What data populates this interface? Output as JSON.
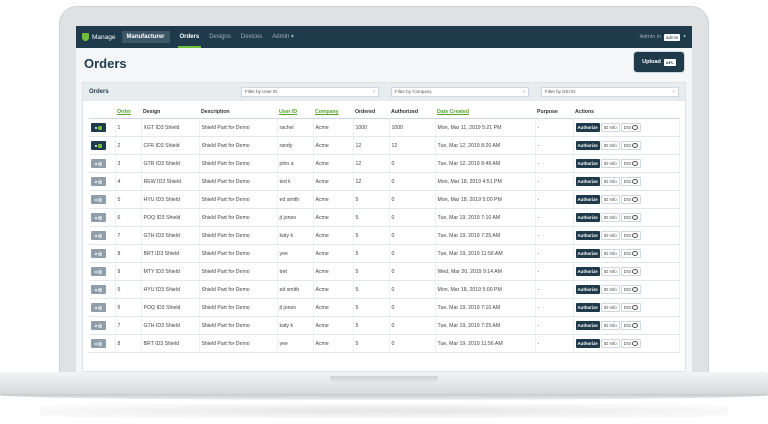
{
  "nav": {
    "brand": "Manage",
    "role": "Manufacturer",
    "items": [
      {
        "label": "Orders",
        "active": true
      },
      {
        "label": "Designs",
        "active": false
      },
      {
        "label": "Devices",
        "active": false
      },
      {
        "label": "Admin ▾",
        "active": false
      }
    ],
    "user_prefix": "Admin in",
    "user_badge": "admin"
  },
  "page": {
    "title": "Orders",
    "upload_label": "Upload",
    "upload_badge": "APL"
  },
  "orders_panel": {
    "title": "Orders",
    "filters": [
      {
        "placeholder": "Filter by User ID"
      },
      {
        "placeholder": "Filter by Company"
      },
      {
        "placeholder": "Filter by DSI ID"
      }
    ]
  },
  "table": {
    "columns": [
      "",
      "Order",
      "Design",
      "Description",
      "User ID",
      "Company",
      "Ordered",
      "Authorized",
      "Date Created",
      "Purpose",
      "Actions"
    ],
    "action_labels": {
      "authorize": "Authorize",
      "id_info": "ID Info",
      "dsi": "DSI"
    },
    "rows": [
      {
        "enabled": true,
        "order": "1",
        "design": "XGT ID3 Shield",
        "description": "Shield Part for Demo",
        "user_id": "rachel",
        "company": "Acme",
        "ordered": "1000",
        "authorized": "1000",
        "date": "Mon, Mar 11, 2019 5:21 PM",
        "purpose": "-"
      },
      {
        "enabled": true,
        "order": "2",
        "design": "CFR ID3 Shield",
        "description": "Shield Part for Demo",
        "user_id": "randy",
        "company": "Acme",
        "ordered": "12",
        "authorized": "12",
        "date": "Tue, Mar 12, 2019 8:20 AM",
        "purpose": "-"
      },
      {
        "enabled": false,
        "order": "3",
        "design": "GTR ID3 Shield",
        "description": "Shield Part for Demo",
        "user_id": "john a",
        "company": "Acme",
        "ordered": "12",
        "authorized": "0",
        "date": "Tue, Mar 12, 2019 8:49 AM",
        "purpose": "-"
      },
      {
        "enabled": false,
        "order": "4",
        "design": "REW ID3 Shield",
        "description": "Shield Part for Demo",
        "user_id": "ted k",
        "company": "Acme",
        "ordered": "12",
        "authorized": "0",
        "date": "Mon, Mar 18, 2019 4:51 PM",
        "purpose": "-"
      },
      {
        "enabled": false,
        "order": "5",
        "design": "HYU ID3 Shield",
        "description": "Shield Part for Demo",
        "user_id": "ed smith",
        "company": "Acme",
        "ordered": "5",
        "authorized": "0",
        "date": "Mon, Mar 18, 2019 5:00 PM",
        "purpose": "-"
      },
      {
        "enabled": false,
        "order": "6",
        "design": "POQ ID3 Shield",
        "description": "Shield Part for Demo",
        "user_id": "jt jones",
        "company": "Acme",
        "ordered": "5",
        "authorized": "0",
        "date": "Tue, Mar 19, 2019 7:10 AM",
        "purpose": "-"
      },
      {
        "enabled": false,
        "order": "7",
        "design": "GTH ID3 Shield",
        "description": "Shield Part for Demo",
        "user_id": "katy k",
        "company": "Acme",
        "ordered": "5",
        "authorized": "0",
        "date": "Tue, Mar 19, 2019 7:25 AM",
        "purpose": "-"
      },
      {
        "enabled": false,
        "order": "8",
        "design": "BRT ID3 Shield",
        "description": "Shield Part for Demo",
        "user_id": "yee",
        "company": "Acme",
        "ordered": "5",
        "authorized": "0",
        "date": "Tue, Mar 19, 2019 11:56 AM",
        "purpose": "-"
      },
      {
        "enabled": false,
        "order": "9",
        "design": "MTY ID3 Shield",
        "description": "Shield Part for Demo",
        "user_id": "tret",
        "company": "Acme",
        "ordered": "5",
        "authorized": "0",
        "date": "Wed, Mar 20, 2019 9:14 AM",
        "purpose": "-"
      },
      {
        "enabled": false,
        "order": "5",
        "design": "HYU ID3 Shield",
        "description": "Shield Part for Demo",
        "user_id": "ed smith",
        "company": "Acme",
        "ordered": "5",
        "authorized": "0",
        "date": "Mon, Mar 18, 2019 5:00 PM",
        "purpose": "-"
      },
      {
        "enabled": false,
        "order": "6",
        "design": "POQ ID3 Shield",
        "description": "Shield Part for Demo",
        "user_id": "jt jones",
        "company": "Acme",
        "ordered": "5",
        "authorized": "0",
        "date": "Tue, Mar 19, 2019 7:10 AM",
        "purpose": "-"
      },
      {
        "enabled": false,
        "order": "7",
        "design": "GTH ID3 Shield",
        "description": "Shield Part for Demo",
        "user_id": "katy k",
        "company": "Acme",
        "ordered": "5",
        "authorized": "0",
        "date": "Tue, Mar 19, 2019 7:25 AM",
        "purpose": "-"
      },
      {
        "enabled": false,
        "order": "8",
        "design": "BRT ID3 Shield",
        "description": "Shield Part for Demo",
        "user_id": "yee",
        "company": "Acme",
        "ordered": "5",
        "authorized": "0",
        "date": "Tue, Mar 19, 2019 11:56 AM",
        "purpose": "-"
      }
    ]
  },
  "colors": {
    "navy": "#1f3a4a",
    "accent_green": "#6fbf3a",
    "toggle_off": "#8f9ea8"
  }
}
